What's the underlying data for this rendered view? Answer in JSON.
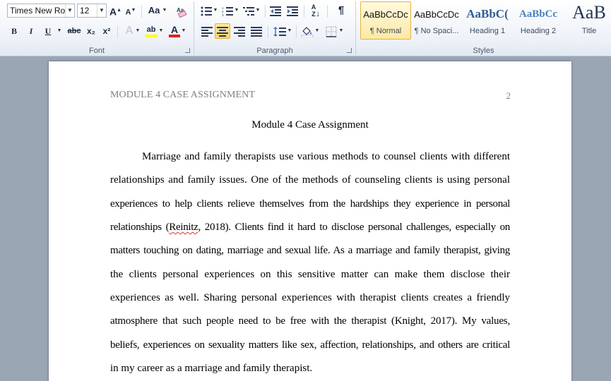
{
  "ribbon": {
    "font": {
      "label": "Font",
      "font_name": "Times New Rom",
      "font_size": "12",
      "grow_label": "A",
      "shrink_label": "A",
      "change_case_label": "Aa",
      "bold_label": "B",
      "italic_label": "I",
      "underline_label": "U",
      "strike_label": "abc",
      "subscript_label": "x₂",
      "superscript_label": "x²",
      "highlight_label": "ab",
      "font_color_label": "A",
      "highlight_color": "#ffff00",
      "font_color": "#e02020"
    },
    "paragraph": {
      "label": "Paragraph",
      "pilcrow": "¶",
      "sort_label": "A↓Z"
    },
    "styles": {
      "label": "Styles",
      "items": [
        {
          "sample": "AaBbCcDc",
          "name": "¶ Normal"
        },
        {
          "sample": "AaBbCcDc",
          "name": "¶ No Spaci..."
        },
        {
          "sample": "AaBbC(",
          "name": "Heading 1"
        },
        {
          "sample": "AaBbCc",
          "name": "Heading 2"
        },
        {
          "sample": "AaB",
          "name": "Title"
        }
      ]
    }
  },
  "document": {
    "header": "MODULE 4 CASE ASSIGNMENT",
    "page_number": "2",
    "title": "Module 4 Case Assignment",
    "lines": [
      "Marriage and family therapists use various methods to counsel clients with different",
      "relationships and family issues. One of the methods of counseling clients is using personal",
      "experiences to help clients relieve themselves from the hardships they experience in personal",
      "relationships (",
      "Reinitz",
      ", 2018). Clients find it hard to disclose personal challenges, especially on",
      "matters touching on dating, marriage and sexual life. As a marriage and family therapist, giving",
      "the clients personal experiences on this sensitive matter can make them disclose their",
      "experiences as well. Sharing personal experiences with therapist clients creates a friendly",
      "atmosphere that such people need to be free with the therapist (Knight, 2017). My values,",
      "beliefs, experiences on sexuality matters like sex, affection, relationships, and others are critical",
      "in my career as a marriage and family therapist."
    ]
  }
}
